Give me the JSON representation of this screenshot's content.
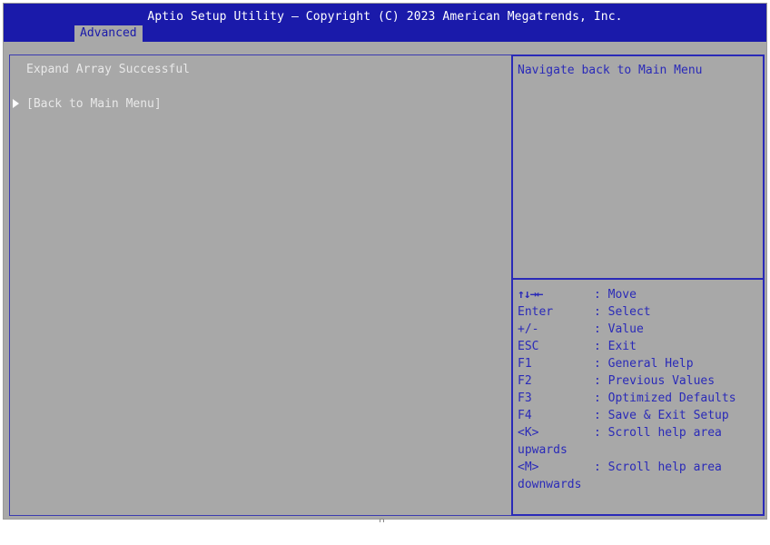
{
  "header": {
    "title": "Aptio Setup Utility – Copyright (C) 2023 American Megatrends, Inc.",
    "active_tab": "Advanced"
  },
  "main": {
    "status": "Expand Array Successful",
    "items": [
      {
        "label": "[Back to Main Menu]"
      }
    ]
  },
  "help": {
    "text": "Navigate back to Main Menu"
  },
  "keys": [
    {
      "key": "↑↓→←",
      "desc": ": Move"
    },
    {
      "key": "Enter",
      "desc": ": Select"
    },
    {
      "key": "+/-",
      "desc": ": Value"
    },
    {
      "key": "ESC",
      "desc": ": Exit"
    },
    {
      "key": "F1",
      "desc": ": General Help"
    },
    {
      "key": "F2",
      "desc": ": Previous Values"
    },
    {
      "key": "F3",
      "desc": ": Optimized Defaults"
    },
    {
      "key": "F4",
      "desc": ": Save & Exit Setup"
    },
    {
      "key": "<K>",
      "desc": ": Scroll help area"
    },
    {
      "key": "upwards",
      "desc": ""
    },
    {
      "key": "<M>",
      "desc": ": Scroll help area"
    },
    {
      "key": "downwards",
      "desc": ""
    }
  ],
  "colors": {
    "title_bar": "#1a1aaa",
    "background": "#a8a8a8",
    "help_text": "#2a2ab8",
    "main_text": "#e8e8e8"
  }
}
